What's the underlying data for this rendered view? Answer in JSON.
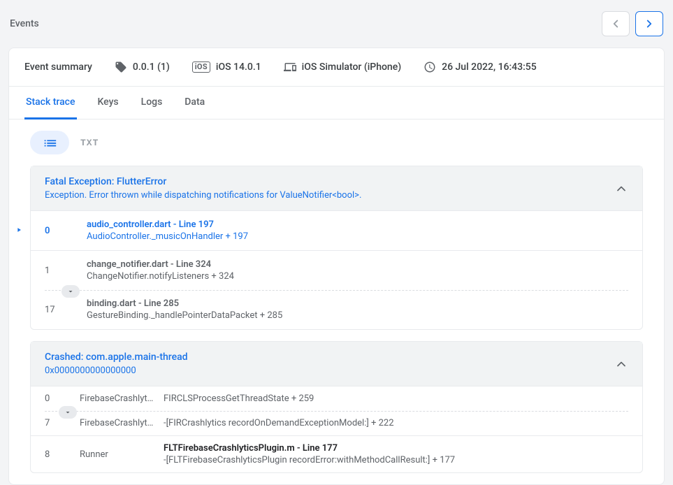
{
  "header": {
    "title": "Events"
  },
  "summary": {
    "label": "Event summary",
    "version": "0.0.1 (1)",
    "os": "iOS 14.0.1",
    "device": "iOS Simulator (iPhone)",
    "datetime": "26 Jul 2022, 16:43:55",
    "ios_badge": "iOS"
  },
  "tabs": {
    "stack_trace": "Stack trace",
    "keys": "Keys",
    "logs": "Logs",
    "data": "Data"
  },
  "toggle": {
    "txt_label": "TXT"
  },
  "panel1": {
    "title": "Fatal Exception: FlutterError",
    "subtitle": "Exception. Error thrown while dispatching notifications for ValueNotifier<bool>.",
    "rows": [
      {
        "num": "0",
        "title": "audio_controller.dart - Line 197",
        "sub": "AudioController._musicOnHandler + 197",
        "highlighted": true
      },
      {
        "num": "1",
        "title": "change_notifier.dart - Line 324",
        "sub": "ChangeNotifier.notifyListeners + 324",
        "highlighted": false
      },
      {
        "num": "17",
        "title": "binding.dart - Line 285",
        "sub": "GestureBinding._handlePointerDataPacket + 285",
        "highlighted": false
      }
    ]
  },
  "panel2": {
    "title": "Crashed: com.apple.main-thread",
    "subtitle": "0x0000000000000000",
    "rows": [
      {
        "num": "0",
        "module": "FirebaseCrashlyt…",
        "title": "",
        "sub": "FIRCLSProcessGetThreadState + 259"
      },
      {
        "num": "7",
        "module": "FirebaseCrashlyt…",
        "title": "",
        "sub": "-[FIRCrashlytics recordOnDemandExceptionModel:] + 222"
      },
      {
        "num": "8",
        "module": "Runner",
        "title": "FLTFirebaseCrashlyticsPlugin.m - Line 177",
        "sub": "-[FLTFirebaseCrashlyticsPlugin recordError:withMethodCallResult:] + 177"
      }
    ]
  }
}
